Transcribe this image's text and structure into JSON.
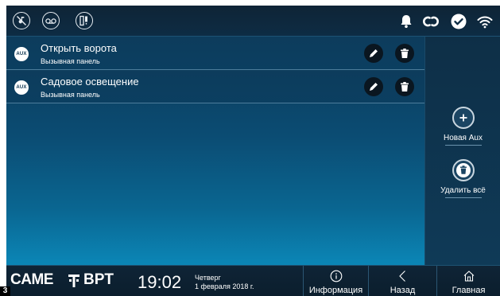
{
  "topbar": {
    "left_icons": [
      "music-off-icon",
      "voicemail-icon",
      "door-status-icon"
    ],
    "right_icons": [
      "bell-icon",
      "link-icon",
      "check-icon",
      "wifi-icon"
    ]
  },
  "list": {
    "items": [
      {
        "badge": "AUX",
        "title": "Открыть ворота",
        "subtitle": "Вызывная панель"
      },
      {
        "badge": "AUX",
        "title": "Садовое освещение",
        "subtitle": "Вызывная панель"
      }
    ]
  },
  "side": {
    "new_aux_label": "Новая Aux",
    "delete_all_label": "Удалить всё"
  },
  "bottom": {
    "brand": "CAME",
    "brand2": "BPT",
    "time": "19:02",
    "day": "Четверг",
    "date": "1 февраля 2018 г.",
    "info_label": "Информация",
    "back_label": "Назад",
    "home_label": "Главная"
  },
  "corner_badge": "3",
  "colors": {
    "accent_dark": "#0f2436",
    "gradient_bottom": "#0c92c4",
    "text": "#ffffff"
  }
}
